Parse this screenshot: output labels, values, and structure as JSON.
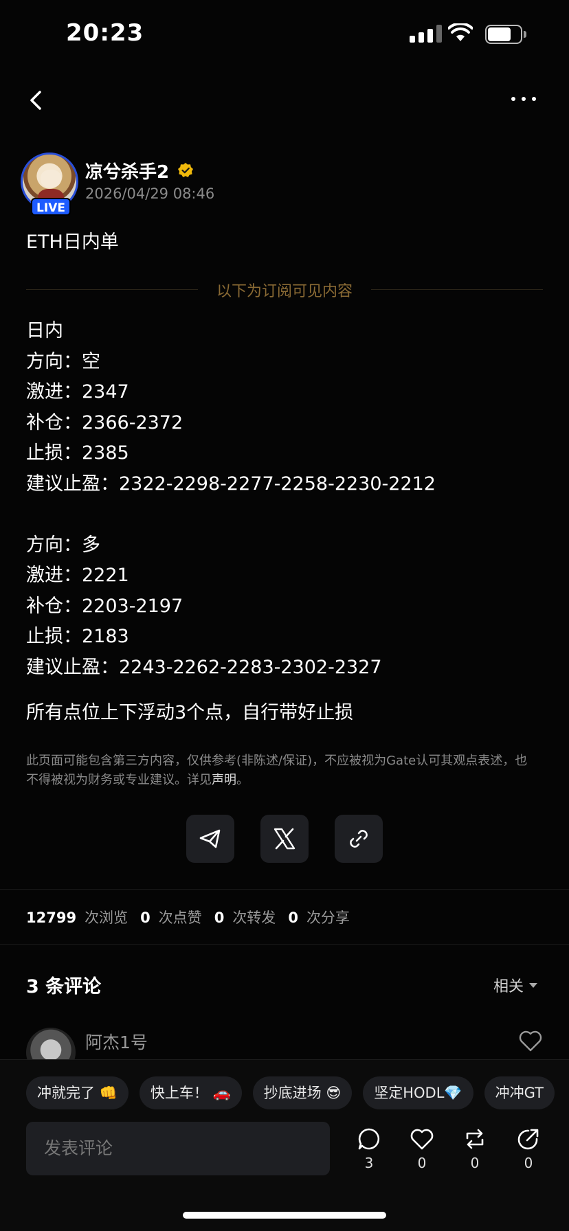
{
  "status_bar": {
    "time": "20:23",
    "battery_level": 0.72
  },
  "author": {
    "name": "凉兮杀手2",
    "live_label": "LIVE",
    "timestamp": "2026/04/29 08:46"
  },
  "post": {
    "title": "ETH日内单",
    "subscriber_divider": "以下为订阅可见内容",
    "lines": [
      "日内",
      "方向：空",
      "激进：2347",
      "补仓：2366-2372",
      "止损：2385",
      "建议止盈：2322-2298-2277-2258-2230-2212",
      "",
      "方向：多",
      "激进：2221",
      "补仓：2203-2197",
      "止损：2183",
      "建议止盈：2243-2262-2283-2302-2327",
      "",
      "所有点位上下浮动3个点，自行带好止损"
    ],
    "disclaimer_text": "此页面可能包含第三方内容，仅供参考(非陈述/保证)，不应被视为Gate认可其观点表述，也不得被视为财务或专业建议。详见",
    "disclaimer_link": "声明",
    "disclaimer_end": "。"
  },
  "share": {
    "icons": [
      "telegram-icon",
      "x-icon",
      "link-icon"
    ]
  },
  "stats": {
    "views": "12799",
    "views_label": "次浏览",
    "likes": "0",
    "likes_label": "次点赞",
    "reposts": "0",
    "reposts_label": "次转发",
    "shares": "0",
    "shares_label": "次分享"
  },
  "comments": {
    "title": "3 条评论",
    "sort_label": "相关",
    "first_author": "阿杰1号"
  },
  "composer": {
    "chips": [
      "冲就完了 👊",
      "快上车！ 🚗",
      "抄底进场 😎",
      "坚定HODL💎",
      "冲冲GT"
    ],
    "placeholder": "发表评论",
    "comment_count": "3",
    "like_count": "0",
    "repost_count": "0",
    "share_count": "0"
  }
}
